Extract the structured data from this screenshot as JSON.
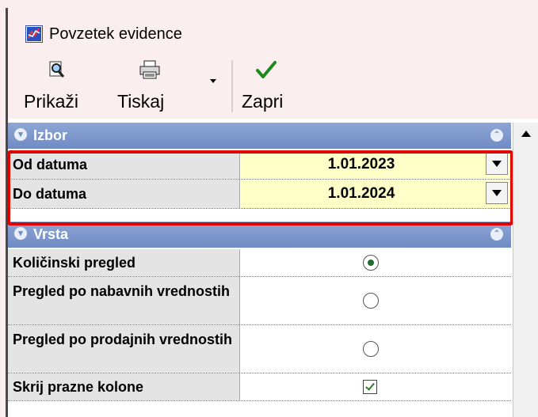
{
  "window": {
    "title": "Povzetek evidence",
    "title_icon": "report-chart-icon"
  },
  "toolbar": {
    "show": {
      "label": "Prikaži",
      "icon": "magnifier-preview-icon"
    },
    "print": {
      "label": "Tiskaj",
      "icon": "printer-icon"
    },
    "close": {
      "label": "Zapri",
      "icon": "green-checkmark-icon"
    }
  },
  "grid": {
    "categories": [
      {
        "label": "Izbor"
      },
      {
        "label": "Vrsta"
      }
    ],
    "date_rows": [
      {
        "label": "Od datuma",
        "value": "1.01.2023"
      },
      {
        "label": "Do datuma",
        "value": "1.01.2024"
      }
    ],
    "type_rows": [
      {
        "label": "Količinski pregled",
        "selected": true
      },
      {
        "label": "Pregled po nabavnih vrednostih",
        "selected": false
      },
      {
        "label": "Pregled po prodajnih vrednostih",
        "selected": false
      },
      {
        "label": "Skrij prazne kolone",
        "checked": true
      }
    ]
  },
  "colors": {
    "category_header": "#7b96cc",
    "date_value_bg": "#ffffc8",
    "highlight": "#e00000"
  }
}
